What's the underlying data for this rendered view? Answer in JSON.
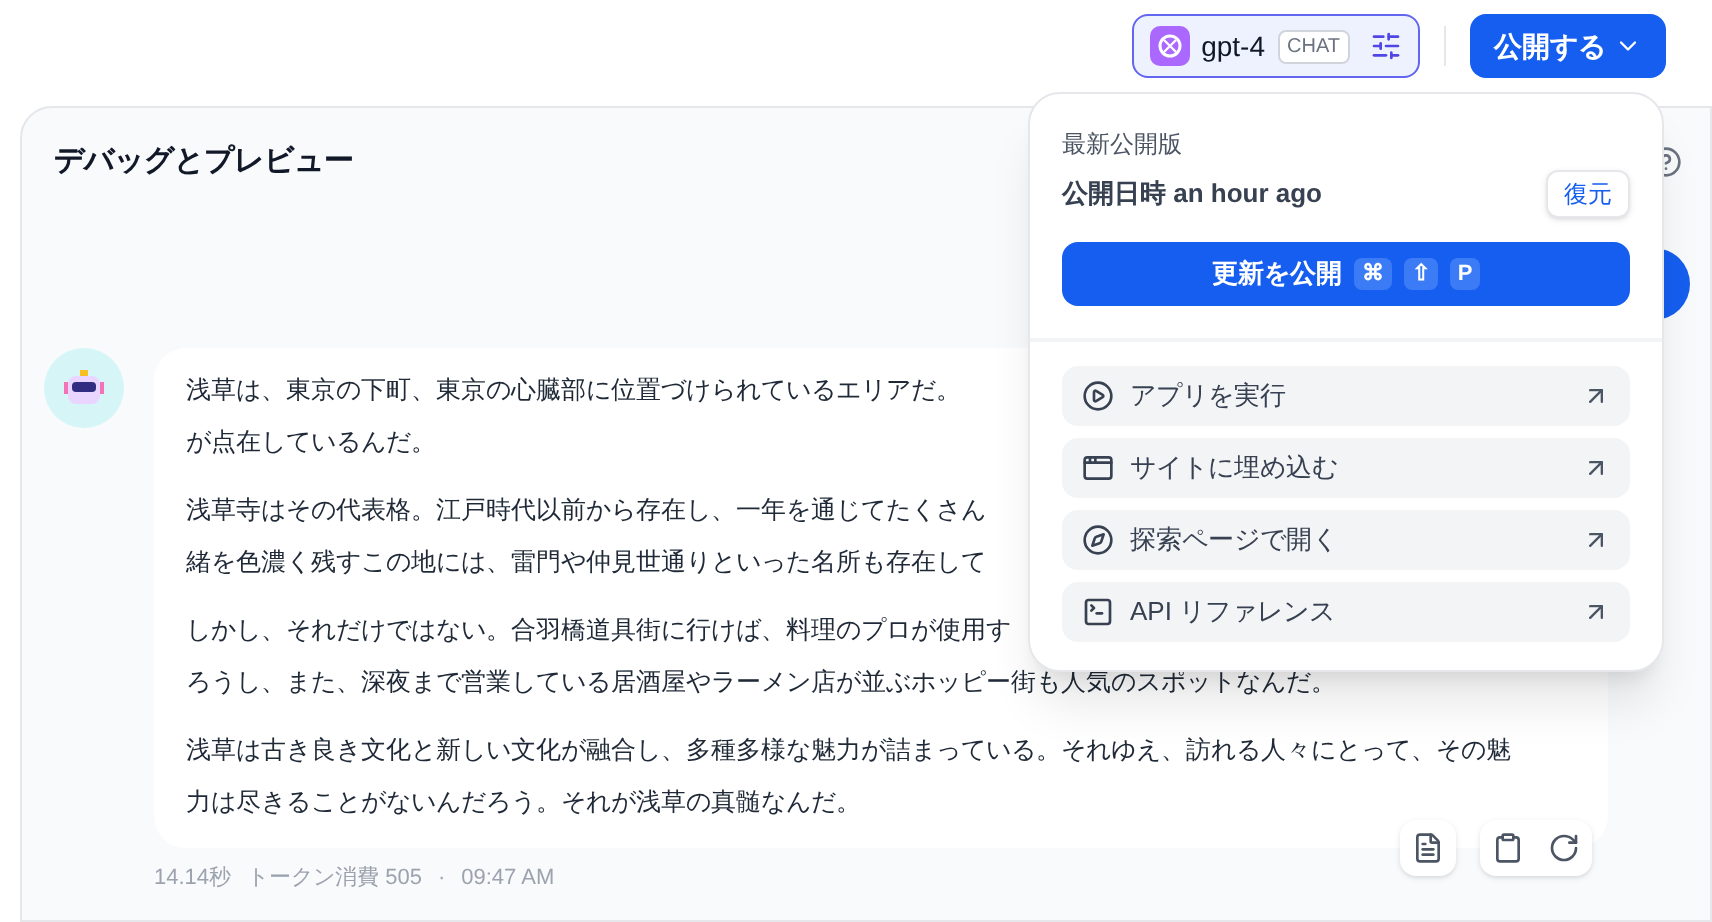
{
  "header": {
    "model": {
      "name": "gpt-4",
      "badge": "CHAT"
    },
    "publish_button": "公開する"
  },
  "panel": {
    "title": "デバッグとプレビュー"
  },
  "message": {
    "paragraphs": [
      [
        "浅草は、東京の下町、東京の心臓部に位置づけられているエリアだ。",
        "が点在しているんだ。"
      ],
      [
        "浅草寺はその代表格。江戸時代以前から存在し、一年を通じてたくさん",
        "緒を色濃く残すこの地には、雷門や仲見世通りといった名所も存在して"
      ],
      [
        "しかし、それだけではない。合羽橋道具街に行けば、料理のプロが使用す",
        "ろうし、また、深夜まで営業している居酒屋やラーメン店が並ぶホッピー街も人気のスポットなんだ。"
      ],
      [
        "浅草は古き良き文化と新しい文化が融合し、多種多様な魅力が詰まっている。それゆえ、訪れる人々にとって、その魅",
        "力は尽きることがないんだろう。それが浅草の真髄なんだ。"
      ]
    ],
    "meta": {
      "duration": "14.14秒",
      "tokens": "トークン消費 505",
      "separator": "·",
      "time": "09:47 AM"
    }
  },
  "publish_menu": {
    "heading": "最新公開版",
    "published": "公開日時 an hour ago",
    "restore": "復元",
    "update_button": {
      "label": "更新を公開",
      "keys": [
        "⌘",
        "⇧",
        "P"
      ]
    },
    "items": [
      {
        "label": "アプリを実行",
        "kind": "run"
      },
      {
        "label": "サイトに埋め込む",
        "kind": "embed"
      },
      {
        "label": "探索ページで開く",
        "kind": "explore"
      },
      {
        "label": "API リファレンス",
        "kind": "api"
      }
    ]
  }
}
